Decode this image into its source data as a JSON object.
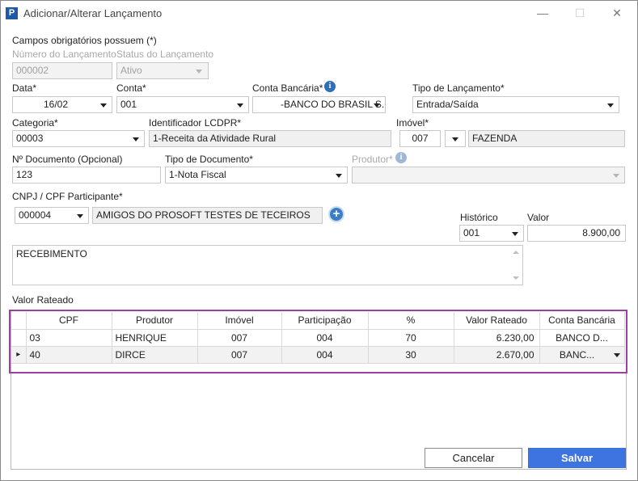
{
  "window": {
    "title": "Adicionar/Alterar Lançamento",
    "app_icon_letter": "P",
    "minimize": "—",
    "maximize": "☐",
    "close": "✕"
  },
  "form": {
    "required_note": "Campos obrigatórios possuem (*)",
    "numero_label": "Número do Lançamento",
    "numero_value": "000002",
    "status_label": "Status do Lançamento",
    "status_value": "Ativo",
    "data_label": "Data*",
    "data_value": "16/02",
    "conta_label": "Conta*",
    "conta_value": "001",
    "conta_bancaria_label": "Conta Bancária*",
    "conta_bancaria_value": "-BANCO DO BRASIL S.",
    "tipo_lancamento_label": "Tipo de Lançamento*",
    "tipo_lancamento_value": "Entrada/Saída",
    "categoria_label": "Categoria*",
    "categoria_value": "00003",
    "lcdpr_label": "Identificador LCDPR*",
    "lcdpr_value": "1-Receita da Atividade Rural",
    "imovel_label": "Imóvel*",
    "imovel_code": "007",
    "imovel_name": "FAZENDA",
    "documento_label": "Nº Documento (Opcional)",
    "documento_value": "123",
    "tipo_documento_label": "Tipo de Documento*",
    "tipo_documento_value": "1-Nota Fiscal",
    "produtor_label": "Produtor*",
    "produtor_value": "",
    "participante_label": "CNPJ / CPF Participante*",
    "participante_code": "000004",
    "participante_name": "AMIGOS DO PROSOFT TESTES DE TECEIROS",
    "historico_label": "Histórico",
    "historico_value": "001",
    "valor_label": "Valor",
    "valor_value": "8.900,00",
    "memo_value": "RECEBIMENTO",
    "rateado_label": "Valor Rateado"
  },
  "grid": {
    "columns": [
      "CPF",
      "Produtor",
      "Imóvel",
      "Participação",
      "%",
      "Valor Rateado",
      "Conta Bancária"
    ],
    "rows": [
      {
        "cpf": "03",
        "produtor": "HENRIQUE",
        "imovel": "007",
        "participacao": "004",
        "pct": "70",
        "valor": "6.230,00",
        "conta": "BANCO D..."
      },
      {
        "cpf": "40",
        "produtor": "DIRCE",
        "imovel": "007",
        "participacao": "004",
        "pct": "30",
        "valor": "2.670,00",
        "conta": "BANC..."
      }
    ],
    "row_indicator": "▸"
  },
  "buttons": {
    "cancel": "Cancelar",
    "save": "Salvar"
  },
  "colors": {
    "accent": "#3d74e0",
    "highlight_border": "#9b3fa3",
    "info_icon": "#2d6fb8"
  }
}
